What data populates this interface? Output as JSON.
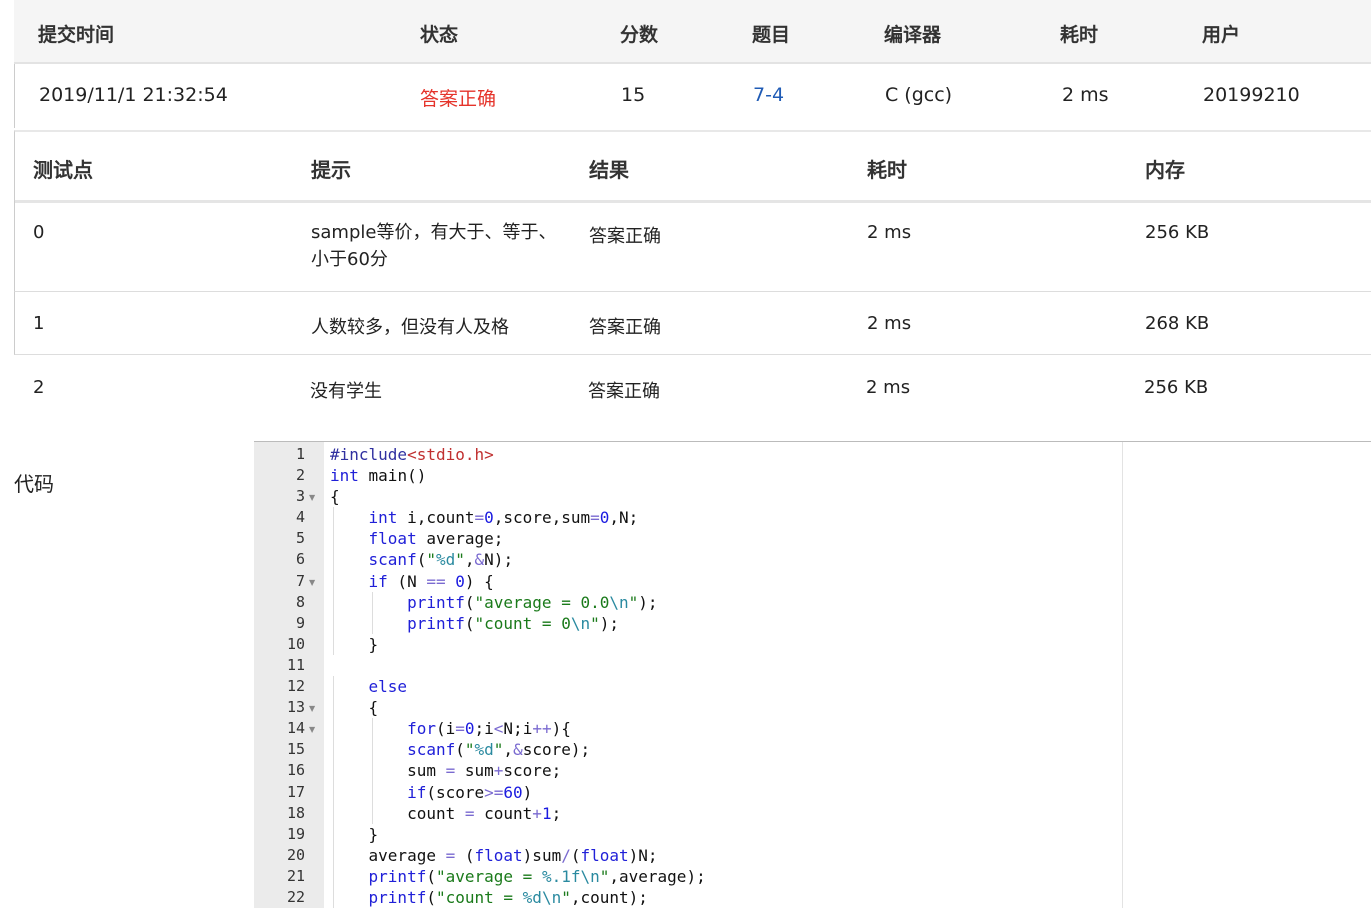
{
  "submission": {
    "headers": {
      "time": "提交时间",
      "status": "状态",
      "score": "分数",
      "problem": "题目",
      "compiler": "编译器",
      "duration": "耗时",
      "user": "用户"
    },
    "row": {
      "time": "2019/11/1 21:32:54",
      "status": "答案正确",
      "score": "15",
      "problem": "7-4",
      "compiler": "C (gcc)",
      "duration": "2 ms",
      "user": "20199210"
    }
  },
  "testcases": {
    "headers": {
      "case": "测试点",
      "hint": "提示",
      "result": "结果",
      "duration": "耗时",
      "memory": "内存"
    },
    "rows": [
      {
        "case": "0",
        "hint": "sample等价，有大于、等于、小于60分",
        "result": "答案正确",
        "duration": "2 ms",
        "memory": "256 KB"
      },
      {
        "case": "1",
        "hint": "人数较多，但没有人及格",
        "result": "答案正确",
        "duration": "2 ms",
        "memory": "268 KB"
      },
      {
        "case": "2",
        "hint": "没有学生",
        "result": "答案正确",
        "duration": "2 ms",
        "memory": "256 KB"
      }
    ]
  },
  "code": {
    "label": "代码",
    "lines": [
      {
        "n": "1",
        "text": "#include<stdio.h>"
      },
      {
        "n": "2",
        "text": "int main()"
      },
      {
        "n": "3",
        "text": "{",
        "fold": true
      },
      {
        "n": "4",
        "text": "    int i,count=0,score,sum=0,N;"
      },
      {
        "n": "5",
        "text": "    float average;"
      },
      {
        "n": "6",
        "text": "    scanf(\"%d\",&N);"
      },
      {
        "n": "7",
        "text": "    if (N == 0) {",
        "fold": true
      },
      {
        "n": "8",
        "text": "        printf(\"average = 0.0\\n\");"
      },
      {
        "n": "9",
        "text": "        printf(\"count = 0\\n\");"
      },
      {
        "n": "10",
        "text": "    }"
      },
      {
        "n": "11",
        "text": ""
      },
      {
        "n": "12",
        "text": "    else"
      },
      {
        "n": "13",
        "text": "    {",
        "fold": true
      },
      {
        "n": "14",
        "text": "        for(i=0;i<N;i++){",
        "fold": true
      },
      {
        "n": "15",
        "text": "        scanf(\"%d\",&score);"
      },
      {
        "n": "16",
        "text": "        sum = sum+score;"
      },
      {
        "n": "17",
        "text": "        if(score>=60)"
      },
      {
        "n": "18",
        "text": "        count = count+1;"
      },
      {
        "n": "19",
        "text": "    }"
      },
      {
        "n": "20",
        "text": "    average = (float)sum/(float)N;"
      },
      {
        "n": "21",
        "text": "    printf(\"average = %.1f\\n\",average);"
      },
      {
        "n": "22",
        "text": "    printf(\"count = %d\\n\",count);"
      }
    ]
  },
  "colors": {
    "accepted": "#e5332a",
    "problem_link": "#1f5bb5",
    "keyword": "#2020d8",
    "string": "#1a7a1a"
  }
}
